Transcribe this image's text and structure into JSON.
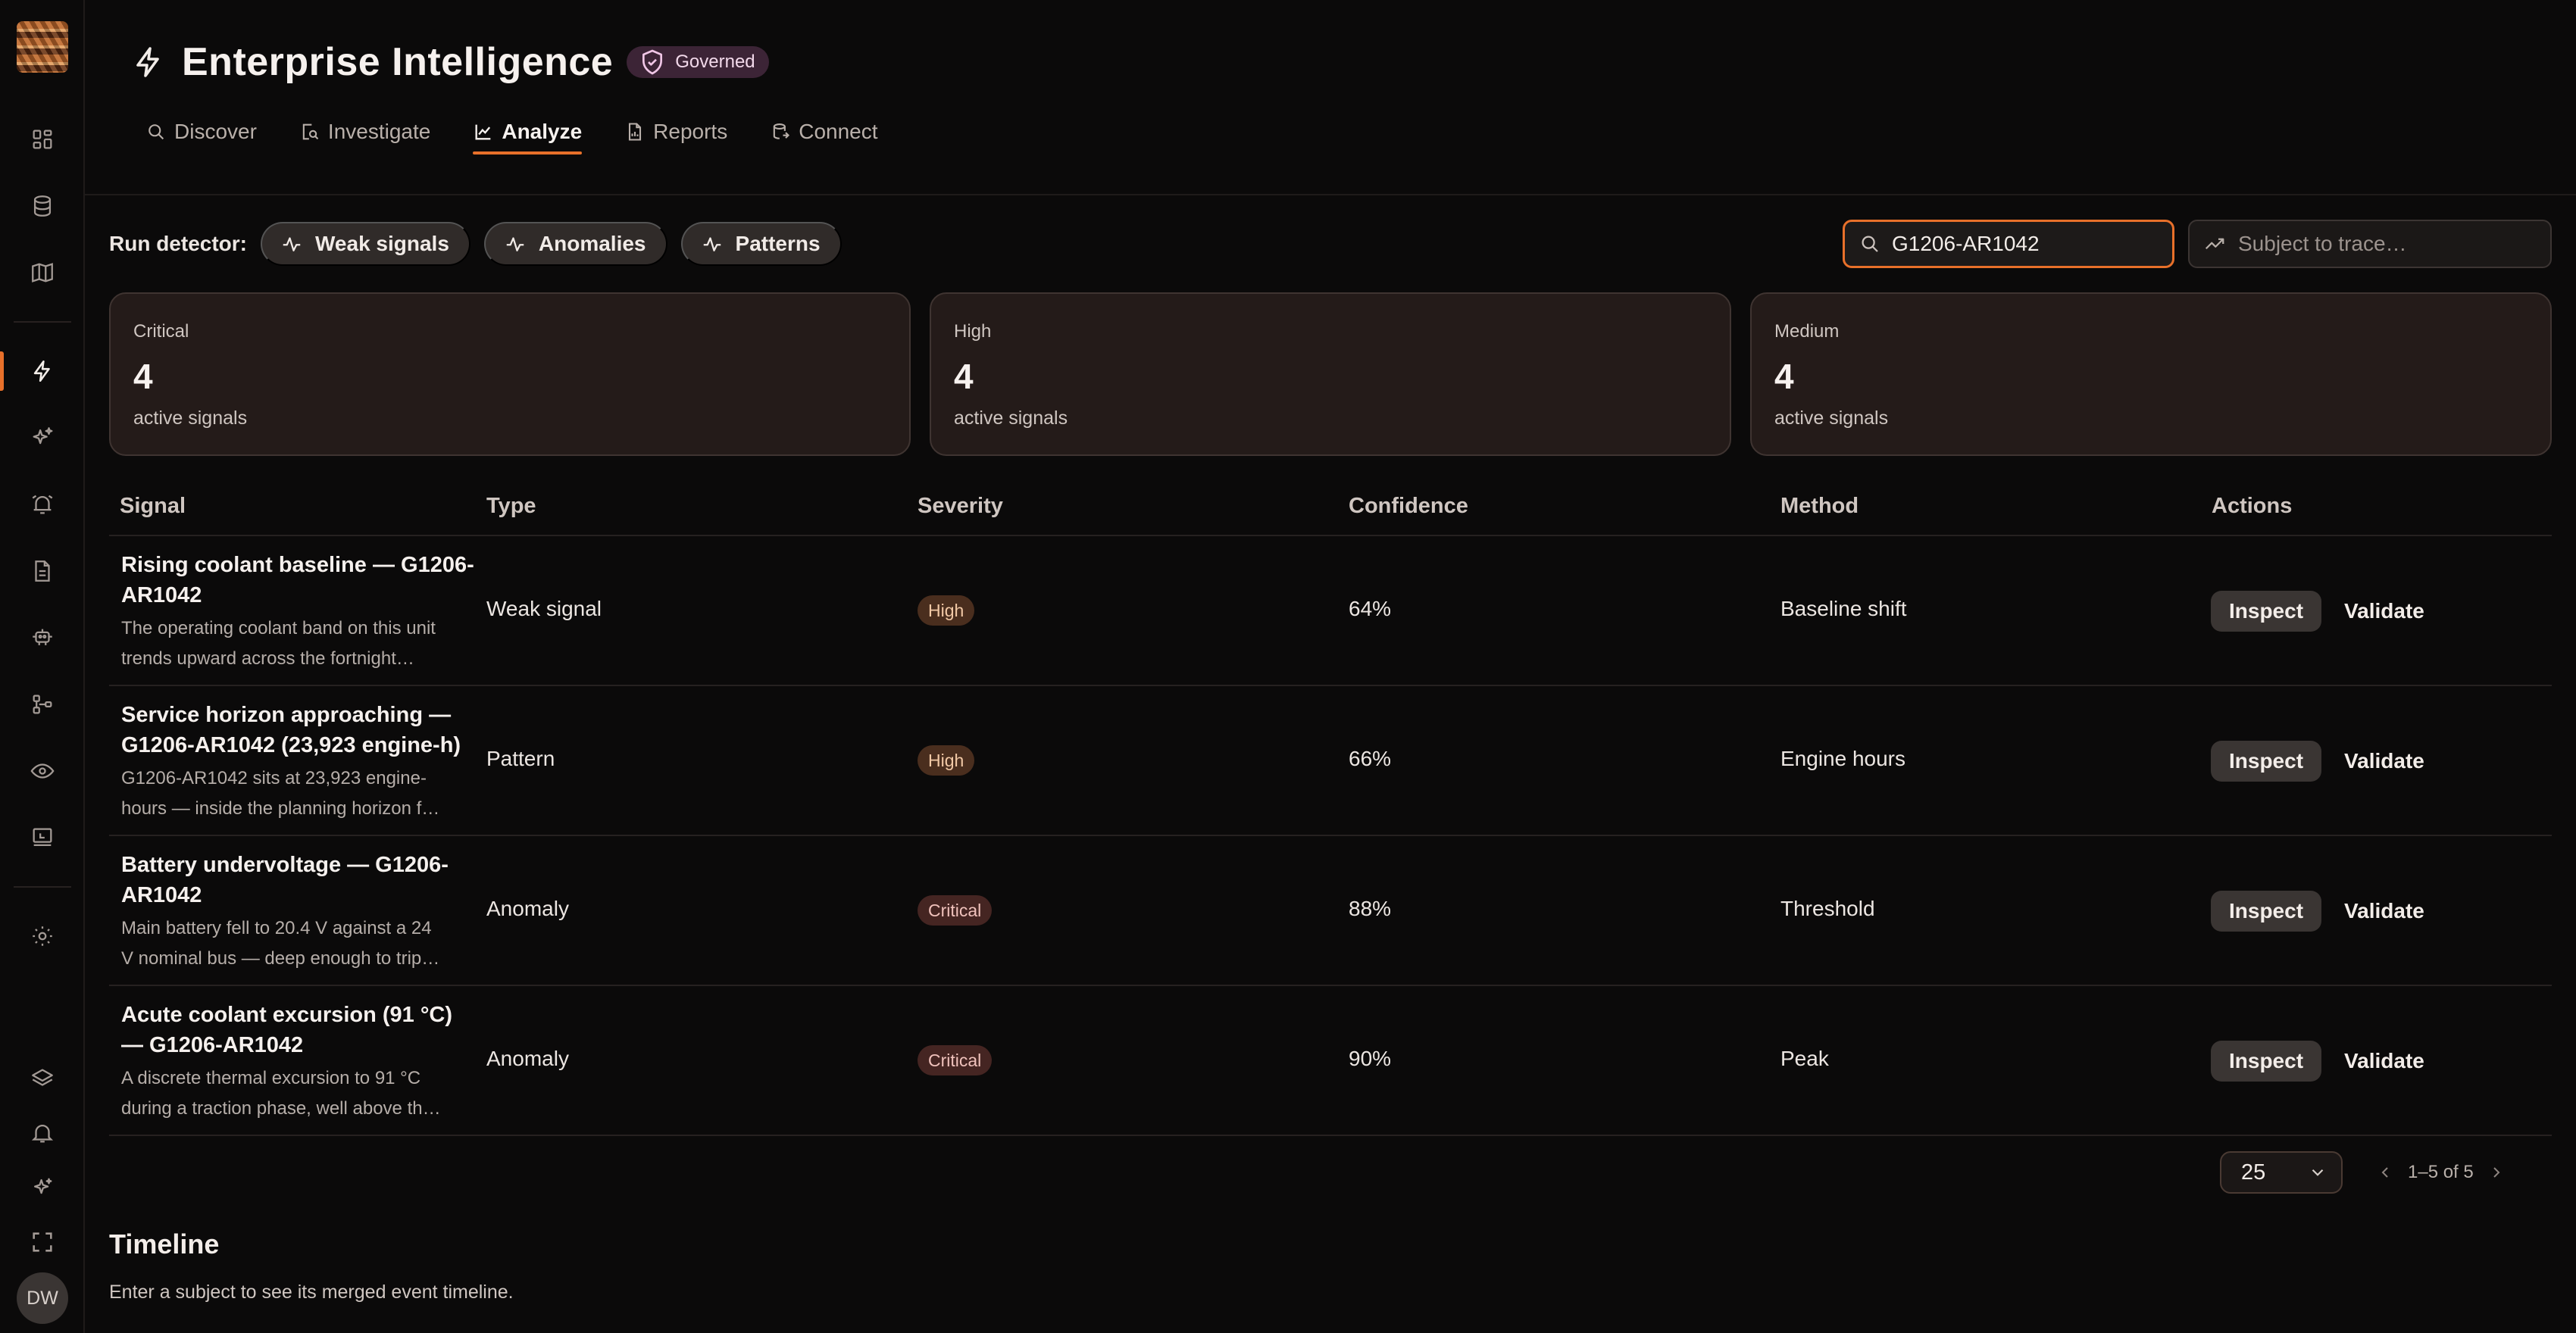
{
  "app": {
    "title": "Enterprise Intelligence",
    "badge": "Governed",
    "avatar_initials": "DW",
    "accent_color": "#e8702a"
  },
  "rail": {
    "items": [
      {
        "icon": "dashboard-icon"
      },
      {
        "icon": "database-icon"
      },
      {
        "icon": "map-icon"
      },
      {
        "icon": "bolt-icon",
        "active": true
      },
      {
        "icon": "sparkles-icon"
      },
      {
        "icon": "alarm-icon"
      },
      {
        "icon": "document-icon"
      },
      {
        "icon": "robot-icon"
      },
      {
        "icon": "workflow-icon"
      },
      {
        "icon": "eye-icon"
      },
      {
        "icon": "monitor-icon"
      },
      {
        "icon": "gear-icon"
      }
    ],
    "bottom": [
      {
        "icon": "layers-icon"
      },
      {
        "icon": "bell-icon"
      },
      {
        "icon": "sparkle-icon"
      },
      {
        "icon": "fullscreen-icon"
      }
    ]
  },
  "tabs": [
    {
      "label": "Discover",
      "icon": "search-icon"
    },
    {
      "label": "Investigate",
      "icon": "investigate-icon"
    },
    {
      "label": "Analyze",
      "icon": "chart-icon",
      "active": true
    },
    {
      "label": "Reports",
      "icon": "report-icon"
    },
    {
      "label": "Connect",
      "icon": "connect-icon"
    }
  ],
  "detector": {
    "label": "Run detector:",
    "buttons": [
      "Weak signals",
      "Anomalies",
      "Patterns"
    ]
  },
  "search": {
    "value": "G1206-AR1042",
    "trace_placeholder": "Subject to trace…"
  },
  "summary": [
    {
      "label": "Critical",
      "value": "4",
      "sub": "active signals"
    },
    {
      "label": "High",
      "value": "4",
      "sub": "active signals"
    },
    {
      "label": "Medium",
      "value": "4",
      "sub": "active signals"
    }
  ],
  "table": {
    "columns": [
      "Signal",
      "Type",
      "Severity",
      "Confidence",
      "Method",
      "Actions"
    ],
    "inspect_label": "Inspect",
    "validate_label": "Validate",
    "rows": [
      {
        "title": "Rising coolant baseline — G1206-AR1042",
        "desc": "The operating coolant band on this unit trends upward across the fortnight before the next service window.",
        "type": "Weak signal",
        "severity": "High",
        "confidence": "64%",
        "method": "Baseline shift"
      },
      {
        "title": "Service horizon approaching — G1206-AR1042 (23,923 engine-h)",
        "desc": "G1206-AR1042 sits at 23,923 engine-hours — inside the planning horizon for the next major overhaul.",
        "type": "Pattern",
        "severity": "High",
        "confidence": "66%",
        "method": "Engine hours"
      },
      {
        "title": "Battery undervoltage — G1206-AR1042",
        "desc": "Main battery fell to 20.4 V against a 24 V nominal bus — deep enough to trip the starter interlock.",
        "type": "Anomaly",
        "severity": "Critical",
        "confidence": "88%",
        "method": "Threshold"
      },
      {
        "title": "Acute coolant excursion (91 °C) — G1206-AR1042",
        "desc": "A discrete thermal excursion to 91 °C during a traction phase, well above the expected operating band.",
        "type": "Anomaly",
        "severity": "Critical",
        "confidence": "90%",
        "method": "Peak"
      }
    ]
  },
  "pagination": {
    "page_size": "25",
    "range": "1–5 of 5"
  },
  "timeline": {
    "title": "Timeline",
    "subtitle": "Enter a subject to see its merged event timeline."
  }
}
